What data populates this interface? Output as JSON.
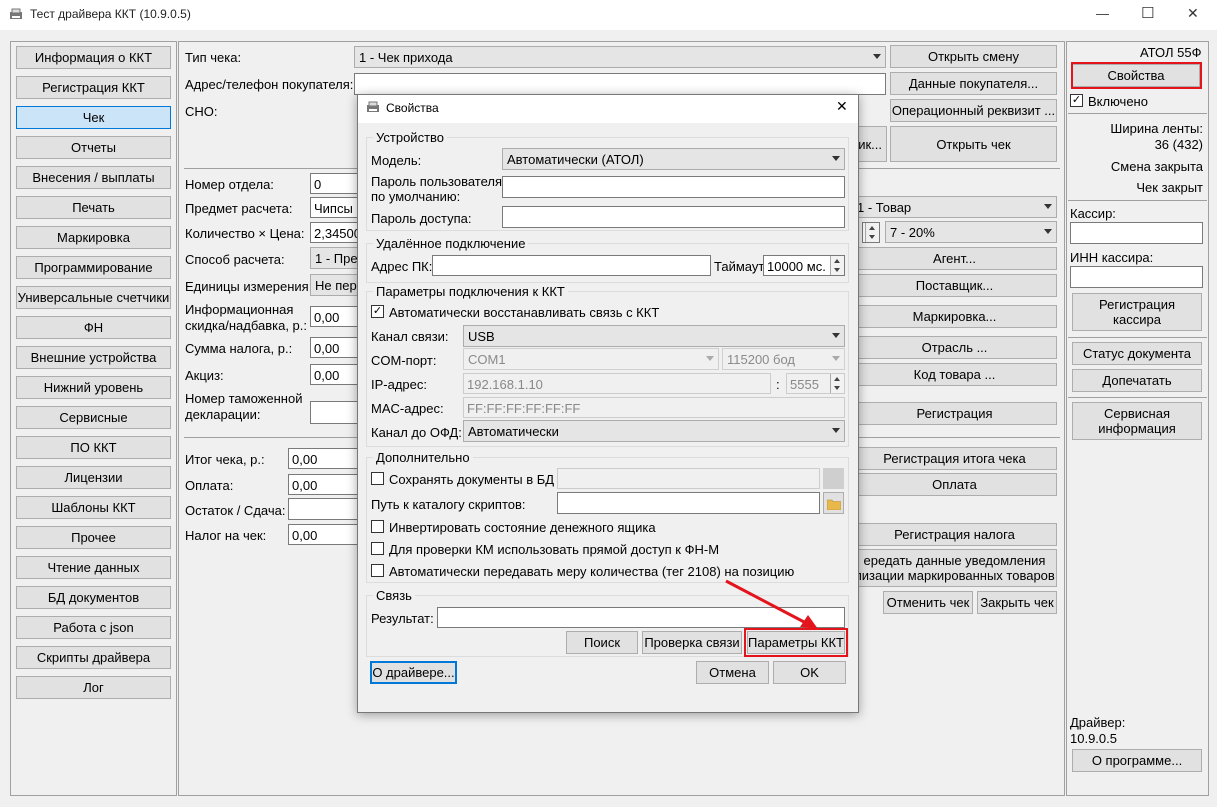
{
  "window": {
    "title": "Тест драйвера ККТ (10.9.0.5)",
    "controls": {
      "minimize": "—",
      "maximize": "☐",
      "close": "✕"
    }
  },
  "left_nav": [
    "Информация о ККТ",
    "Регистрация ККТ",
    "Чек",
    "Отчеты",
    "Внесения / выплаты",
    "Печать",
    "Маркировка",
    "Программирование",
    "Универсальные счетчики",
    "ФН",
    "Внешние устройства",
    "Нижний уровень",
    "Сервисные",
    "ПО ККТ",
    "Лицензии",
    "Шаблоны ККТ",
    "Прочее",
    "Чтение данных",
    "БД документов",
    "Работа с json",
    "Скрипты драйвера",
    "Лог"
  ],
  "main": {
    "receipt_type_label": "Тип чека:",
    "receipt_type_value": "1 - Чек прихода",
    "buyer_label": "Адрес/телефон покупателя:",
    "sno_label": "СНО:",
    "btn_open_shift": "Открыть смену",
    "btn_buyer_data": "Данные покупателя...",
    "btn_op_requisite": "Операционный реквизит ...",
    "btn_partial": "ик...",
    "btn_open_receipt": "Открыть чек",
    "dept_label": "Номер отдела:",
    "dept_value": "0",
    "subject_label": "Предмет расчета:",
    "subject_value": "Чипсы с",
    "qty_label": "Количество × Цена:",
    "qty_value": "2,34500",
    "method_label": "Способ расчета:",
    "method_value": "1 - Пре",
    "units_label": "Единицы измерения:",
    "units_value": "Не пер",
    "discount_label_1": "Информационная",
    "discount_label_2": "скидка/надбавка, р.:",
    "discount_value": "0,00",
    "tax_sum_label": "Сумма налога, р.:",
    "tax_sum_value": "0,00",
    "excise_label": "Акциз:",
    "excise_value": "0,00",
    "customs_label_1": "Номер таможенной",
    "customs_label_2": "декларации:",
    "item_type_value": "1 - Товар",
    "vat_value": "7 - 20%",
    "btn_agent": "Агент...",
    "btn_supplier": "Поставщик...",
    "btn_marking": "Маркировка...",
    "btn_industry": "Отрасль ...",
    "btn_item_code": "Код товара ...",
    "btn_registration": "Регистрация",
    "total_label": "Итог чека, р.:",
    "total_value": "0,00",
    "payment_label": "Оплата:",
    "payment_value": "0,00",
    "change_label": "Остаток / Сдача:",
    "receipt_tax_label": "Налог на чек:",
    "receipt_tax_value": "0,00",
    "btn_total_reg": "Регистрация итога чека",
    "btn_payment": "Оплата",
    "btn_tax_reg": "Регистрация налога",
    "btn_notify_1": "ередать данные уведомления",
    "btn_notify_2": "лизации маркированных товаров",
    "btn_cancel_receipt": "Отменить чек",
    "btn_close_receipt": "Закрыть чек"
  },
  "right_panel": {
    "model": "АТОЛ 55Ф",
    "btn_properties": "Свойства",
    "enabled_label": "Включено",
    "enabled_checked": true,
    "tape_width_label": "Ширина ленты:",
    "tape_width_value": "36 (432)",
    "shift_status": "Смена закрыта",
    "receipt_status": "Чек закрыт",
    "cashier_label": "Кассир:",
    "cashier_inn_label": "ИНН кассира:",
    "btn_reg_cashier_1": "Регистрация",
    "btn_reg_cashier_2": "кассира",
    "btn_doc_status": "Статус документа",
    "btn_reprint": "Допечатать",
    "btn_service_1": "Сервисная",
    "btn_service_2": "информация",
    "driver_label": "Драйвер:",
    "driver_version": "10.9.0.5",
    "btn_about": "О программе..."
  },
  "dialog": {
    "title": "Свойства",
    "close": "✕",
    "device_group": "Устройство",
    "model_label": "Модель:",
    "model_value": "Автоматически (АТОЛ)",
    "default_pwd_label_1": "Пароль пользователя",
    "default_pwd_label_2": "по умолчанию:",
    "access_pwd_label": "Пароль доступа:",
    "remote_group": "Удалённое подключение",
    "pc_addr_label": "Адрес ПК:",
    "timeout_label": "Таймаут",
    "timeout_value": "10000 мс.",
    "conn_group": "Параметры подключения к ККТ",
    "auto_restore_label": "Автоматически восстанавливать связь с ККТ",
    "auto_restore_checked": true,
    "channel_label": "Канал связи:",
    "channel_value": "USB",
    "com_label": "COM-порт:",
    "com_value": "COM1",
    "baud_value": "115200 бод",
    "ip_label": "IP-адрес:",
    "ip_value": "192.168.1.10",
    "ip_colon": ":",
    "port_value": "5555",
    "mac_label": "MAC-адрес:",
    "mac_value": "FF:FF:FF:FF:FF:FF",
    "ofd_label": "Канал до ОФД:",
    "ofd_value": "Автоматически",
    "extra_group": "Дополнительно",
    "save_db_label": "Сохранять документы в БД",
    "scripts_path_label": "Путь к каталогу скриптов:",
    "invert_drawer_label": "Инвертировать состояние денежного ящика",
    "direct_fn_label": "Для проверки КМ использовать прямой доступ к ФН-М",
    "auto_qty_label": "Автоматически передавать меру количества (тег 2108) на позицию",
    "link_group": "Связь",
    "result_label": "Результат:",
    "btn_search": "Поиск",
    "btn_check": "Проверка связи",
    "btn_params": "Параметры ККТ",
    "btn_about_driver": "О драйвере...",
    "btn_cancel": "Отмена",
    "btn_ok": "OK"
  },
  "colors": {
    "highlight_red": "#e3141c",
    "selected_blue": "#cce4f7"
  }
}
